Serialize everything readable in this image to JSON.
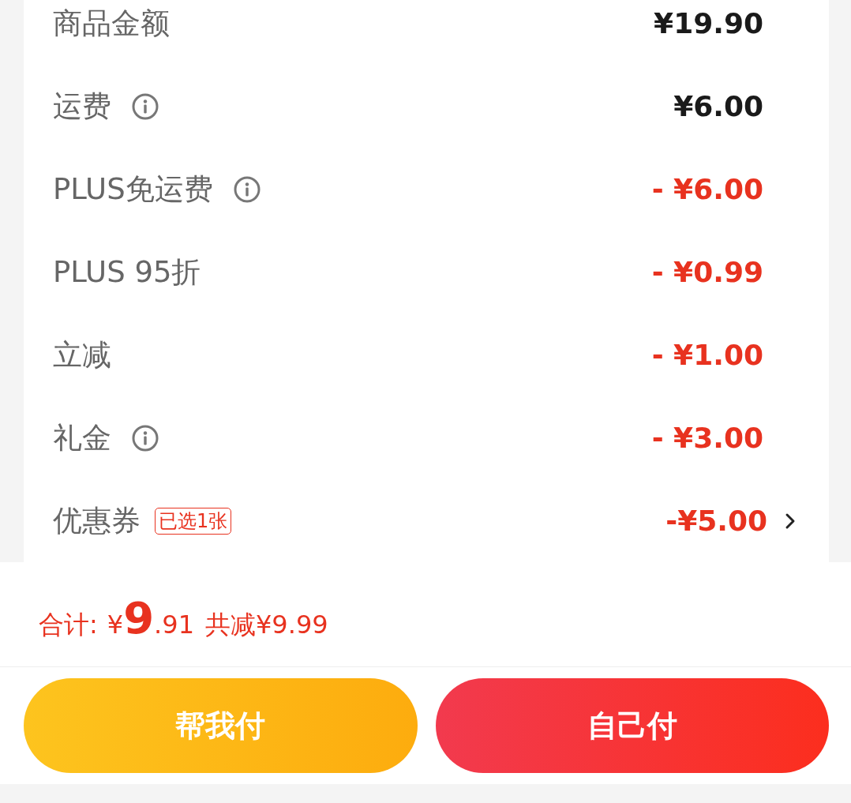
{
  "rows": [
    {
      "label": "商品金额",
      "info": false,
      "value": "¥19.90",
      "kind": "normal",
      "link": false
    },
    {
      "label": "运费",
      "info": true,
      "value": "¥6.00",
      "kind": "normal",
      "link": false
    },
    {
      "label": "PLUS免运费",
      "info": true,
      "value": "- ¥6.00",
      "kind": "discount",
      "link": false
    },
    {
      "label": "PLUS 95折",
      "info": false,
      "value": "- ¥0.99",
      "kind": "discount",
      "link": false
    },
    {
      "label": "立减",
      "info": false,
      "value": "- ¥1.00",
      "kind": "discount",
      "link": false
    },
    {
      "label": "礼金",
      "info": true,
      "value": "- ¥3.00",
      "kind": "discount",
      "link": false
    },
    {
      "label": "优惠券",
      "info": false,
      "badge": "已选1张",
      "value": "-¥5.00",
      "kind": "discount",
      "link": true
    }
  ],
  "total": {
    "label": "合计:",
    "currency": "¥",
    "integer": "9",
    "decimal": ".91",
    "saved": "共减¥9.99"
  },
  "buttons": [
    {
      "label": "帮我付",
      "kind": "secondary"
    },
    {
      "label": "自己付",
      "kind": "primary"
    }
  ]
}
